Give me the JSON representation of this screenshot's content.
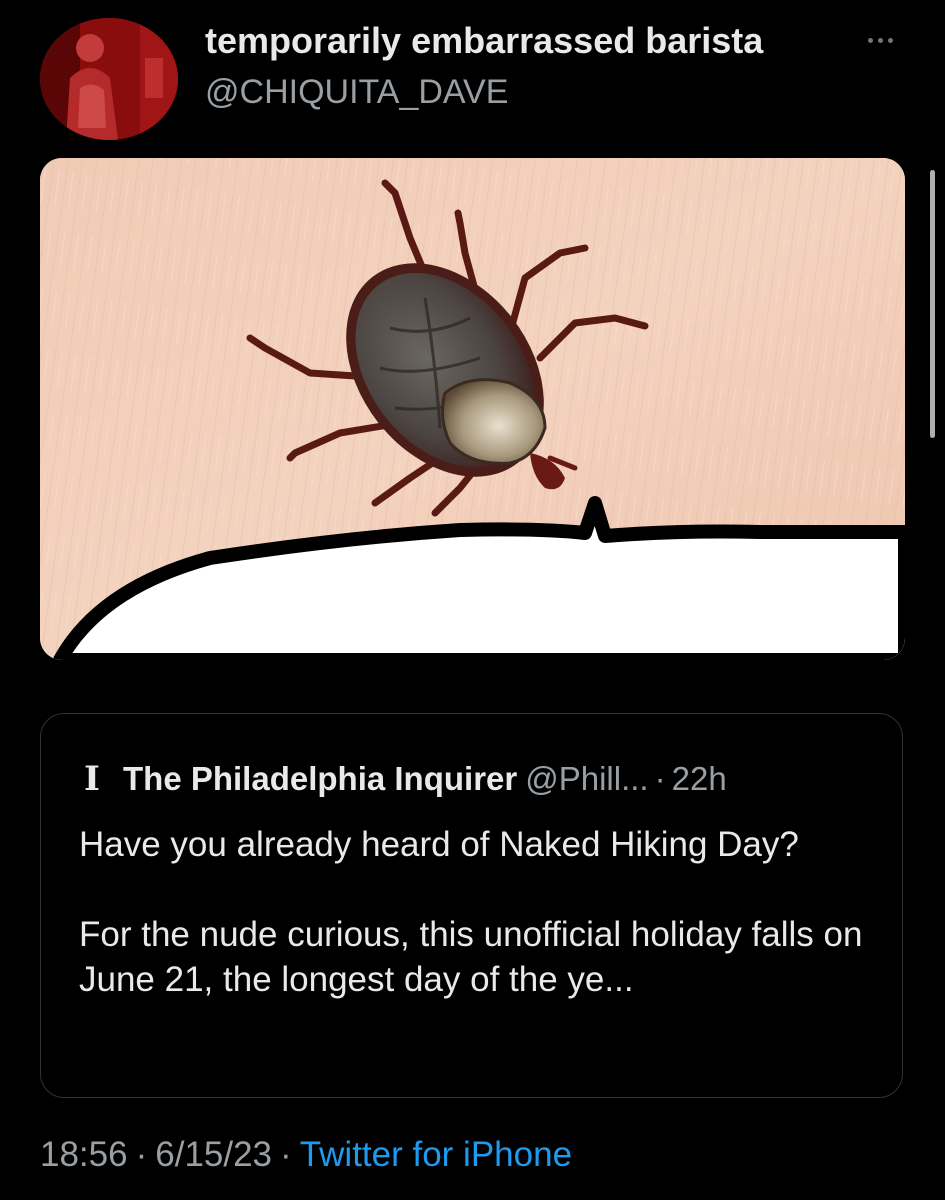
{
  "tweet": {
    "display_name": "temporarily embarrassed barista",
    "handle": "@CHIQUITA_DAVE",
    "avatar_icon": "avatar-photo",
    "more_icon": "more-options-icon",
    "media_icon": "tick-on-skin-image"
  },
  "quote": {
    "logo_icon": "inquirer-logo-icon",
    "logo_glyph": "I",
    "name": "The Philadelphia Inquirer",
    "handle": "@Phill...",
    "separator": "·",
    "time": "22h",
    "text_line1": "Have you already heard of Naked Hiking Day?",
    "text_line2": "For the nude curious, this unofficial holiday falls on June 21, the longest day of the ye..."
  },
  "meta": {
    "time": "18:56",
    "separator": "·",
    "date": "6/15/23",
    "source": "Twitter for iPhone"
  },
  "colors": {
    "background": "#000000",
    "primary_text": "#e7e9ea",
    "secondary_text": "#9a9fa4",
    "link": "#1d9bf0",
    "border": "#2f3336"
  }
}
